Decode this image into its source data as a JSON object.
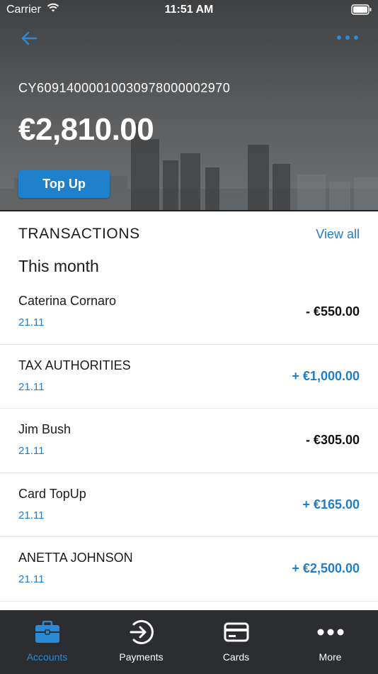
{
  "status_bar": {
    "carrier": "Carrier",
    "time": "11:51 AM"
  },
  "account": {
    "iban": "CY60914000010030978000002970",
    "balance": "€2,810.00",
    "topup_label": "Top Up"
  },
  "transactions": {
    "title": "TRANSACTIONS",
    "view_all": "View all",
    "period": "This month",
    "items": [
      {
        "name": "Caterina Cornaro",
        "date": "21.11",
        "amount": "- €550.00",
        "kind": "debit"
      },
      {
        "name": "TAX AUTHORITIES",
        "date": "21.11",
        "amount": "+ €1,000.00",
        "kind": "credit"
      },
      {
        "name": "Jim Bush",
        "date": "21.11",
        "amount": "- €305.00",
        "kind": "debit"
      },
      {
        "name": "Card TopUp",
        "date": "21.11",
        "amount": "+ €165.00",
        "kind": "credit"
      },
      {
        "name": "ANETTA JOHNSON",
        "date": "21.11",
        "amount": "+ €2,500.00",
        "kind": "credit"
      }
    ]
  },
  "nav": {
    "items": [
      {
        "label": "Accounts",
        "icon": "briefcase-icon",
        "active": true
      },
      {
        "label": "Payments",
        "icon": "arrow-circle-icon",
        "active": false
      },
      {
        "label": "Cards",
        "icon": "card-icon",
        "active": false
      },
      {
        "label": "More",
        "icon": "dots-icon",
        "active": false
      }
    ]
  },
  "colors": {
    "accent": "#1f7dc9",
    "button": "#1f80cc",
    "nav_bg": "#2b2d30",
    "nav_active": "#2a8ad6",
    "debit": "#111111",
    "credit": "#1f7dc9"
  }
}
